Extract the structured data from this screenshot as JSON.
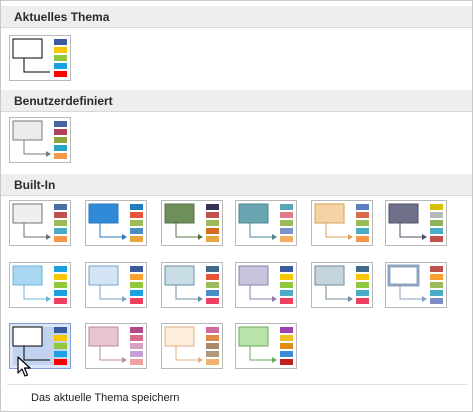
{
  "sections": {
    "current": "Aktuelles Thema",
    "custom": "Benutzerdefiniert",
    "builtin": "Built-In"
  },
  "footer": {
    "save_label": "Das aktuelle Thema speichern"
  },
  "themes": {
    "current": {
      "fill": "#ffffff",
      "stroke": "#000000",
      "line": "#000000",
      "arrow": false,
      "swatches": [
        "#3b5aa0",
        "#f7c600",
        "#92c83e",
        "#1ba1e2",
        "#ff0000"
      ]
    },
    "custom": {
      "fill": "#ececec",
      "stroke": "#7a7a7a",
      "line": "#7a7a7a",
      "arrow": true,
      "swatches": [
        "#4a63a3",
        "#b0435a",
        "#8aa63c",
        "#26a3c6",
        "#f59a4b"
      ]
    },
    "builtin": [
      {
        "fill": "#efefef",
        "stroke": "#707070",
        "line": "#707070",
        "arrow": true,
        "swatches": [
          "#4a6fa5",
          "#c0504d",
          "#9bbb59",
          "#4bacc6",
          "#f79646"
        ]
      },
      {
        "fill": "#2f8ad8",
        "stroke": "#2a79bf",
        "line": "#2a79bf",
        "arrow": true,
        "swatches": [
          "#1f7ebd",
          "#e8543a",
          "#9bbb59",
          "#4b8bc6",
          "#e5a640"
        ]
      },
      {
        "fill": "#6f8f5a",
        "stroke": "#56704a",
        "line": "#56704a",
        "arrow": true,
        "swatches": [
          "#333355",
          "#c0504d",
          "#9bbb59",
          "#d66a1f",
          "#e5a640"
        ]
      },
      {
        "fill": "#6aa6b2",
        "stroke": "#4c8793",
        "line": "#4c8793",
        "arrow": true,
        "swatches": [
          "#5aa7b7",
          "#e27a8a",
          "#9bbb59",
          "#7d93c8",
          "#f0b060"
        ]
      },
      {
        "fill": "#f6d3a4",
        "stroke": "#d9a25a",
        "line": "#d9a25a",
        "arrow": true,
        "swatches": [
          "#5b7fc0",
          "#d96a4a",
          "#9bbb59",
          "#4bacc6",
          "#f79646"
        ]
      },
      {
        "fill": "#6d7088",
        "stroke": "#4f5266",
        "line": "#4f5266",
        "arrow": true,
        "swatches": [
          "#d7c000",
          "#b9b9b9",
          "#8fb35a",
          "#4bacc6",
          "#c0504d"
        ]
      },
      {
        "fill": "#a9d7f2",
        "stroke": "#6cb3d9",
        "line": "#6cb3d9",
        "arrow": true,
        "swatches": [
          "#1ba1e2",
          "#f7c600",
          "#92c83e",
          "#1ba1e2",
          "#f04060"
        ]
      },
      {
        "fill": "#d3e4f4",
        "stroke": "#7aa2c7",
        "line": "#7aa2c7",
        "arrow": true,
        "swatches": [
          "#3b5aa0",
          "#f7a030",
          "#92c83e",
          "#1ba1e2",
          "#f04060"
        ]
      },
      {
        "fill": "#c8dde6",
        "stroke": "#6e8ea0",
        "line": "#6e8ea0",
        "arrow": true,
        "swatches": [
          "#3f6a8c",
          "#e8543a",
          "#9bbb59",
          "#4b8bc6",
          "#f04060"
        ]
      },
      {
        "fill": "#c9c3dc",
        "stroke": "#8a80ad",
        "line": "#8a80ad",
        "arrow": true,
        "swatches": [
          "#3b5aa0",
          "#f7c600",
          "#92c83e",
          "#4bacc6",
          "#f04060"
        ]
      },
      {
        "fill": "#c4d4dc",
        "stroke": "#6f8c98",
        "line": "#6f8c98",
        "arrow": true,
        "swatches": [
          "#3f6a8c",
          "#f7c600",
          "#92c83e",
          "#4bacc6",
          "#f04060"
        ]
      },
      {
        "fill": "#ffffff",
        "stroke": "#8ca2bd",
        "line": "#8ca2bd",
        "arrow": true,
        "thick": true,
        "swatches": [
          "#c0504d",
          "#f7a030",
          "#9bbb59",
          "#4bacc6",
          "#7b8fc6"
        ]
      },
      {
        "fill": "#ffffff",
        "stroke": "#000000",
        "line": "#000000",
        "arrow": false,
        "swatches": [
          "#3b5aa0",
          "#f7c600",
          "#92c83e",
          "#1ba1e2",
          "#ff0000"
        ]
      },
      {
        "fill": "#e9c6cf",
        "stroke": "#b88a95",
        "line": "#b88a95",
        "arrow": true,
        "swatches": [
          "#b04a8a",
          "#d96a8a",
          "#d8a0c0",
          "#c8a0d8",
          "#f0a0a0"
        ]
      },
      {
        "fill": "#fdeedd",
        "stroke": "#e0b080",
        "line": "#e0b080",
        "arrow": true,
        "swatches": [
          "#d06a9a",
          "#e08a4a",
          "#a88a6a",
          "#b09a7a",
          "#f0b070"
        ]
      },
      {
        "fill": "#b9e3a8",
        "stroke": "#6aa85a",
        "line": "#6aa85a",
        "arrow": true,
        "swatches": [
          "#a040b0",
          "#f0c020",
          "#e08a20",
          "#3a8ad8",
          "#c02020"
        ]
      }
    ]
  }
}
